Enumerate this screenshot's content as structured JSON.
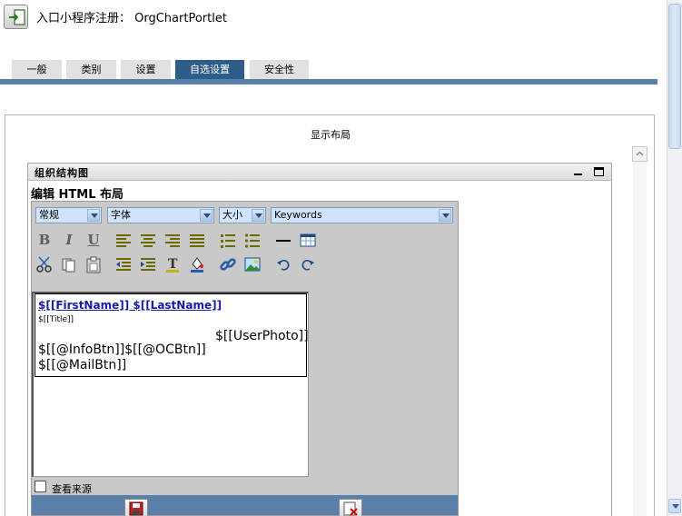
{
  "header": {
    "title": "入口小程序注册： OrgChartPortlet"
  },
  "tabs": [
    {
      "label": "一般"
    },
    {
      "label": "类别"
    },
    {
      "label": "设置"
    },
    {
      "label": "自选设置"
    },
    {
      "label": "安全性"
    }
  ],
  "active_tab": "自选设置",
  "panel": {
    "title": "显示布局"
  },
  "portlet": {
    "title": "组织结构图"
  },
  "editor": {
    "heading": "编辑 HTML 布局",
    "selects": {
      "format": "常规",
      "font": "字体",
      "size": "大小",
      "keywords": "Keywords"
    },
    "content": {
      "name_line": "$[[FirstName]] $[[LastName]]",
      "title_line": "$[[Title]]",
      "photo_line": "$[[UserPhoto]]",
      "buttons_line": "$[[@InfoBtn]]$[[@OCBtn]]",
      "mail_line": "$[[@MailBtn]]"
    },
    "view_source_label": "查看来源"
  },
  "colors": {
    "accent": "#2f5d8a",
    "bar": "#5a7fa8",
    "link": "#1a1aa8"
  }
}
